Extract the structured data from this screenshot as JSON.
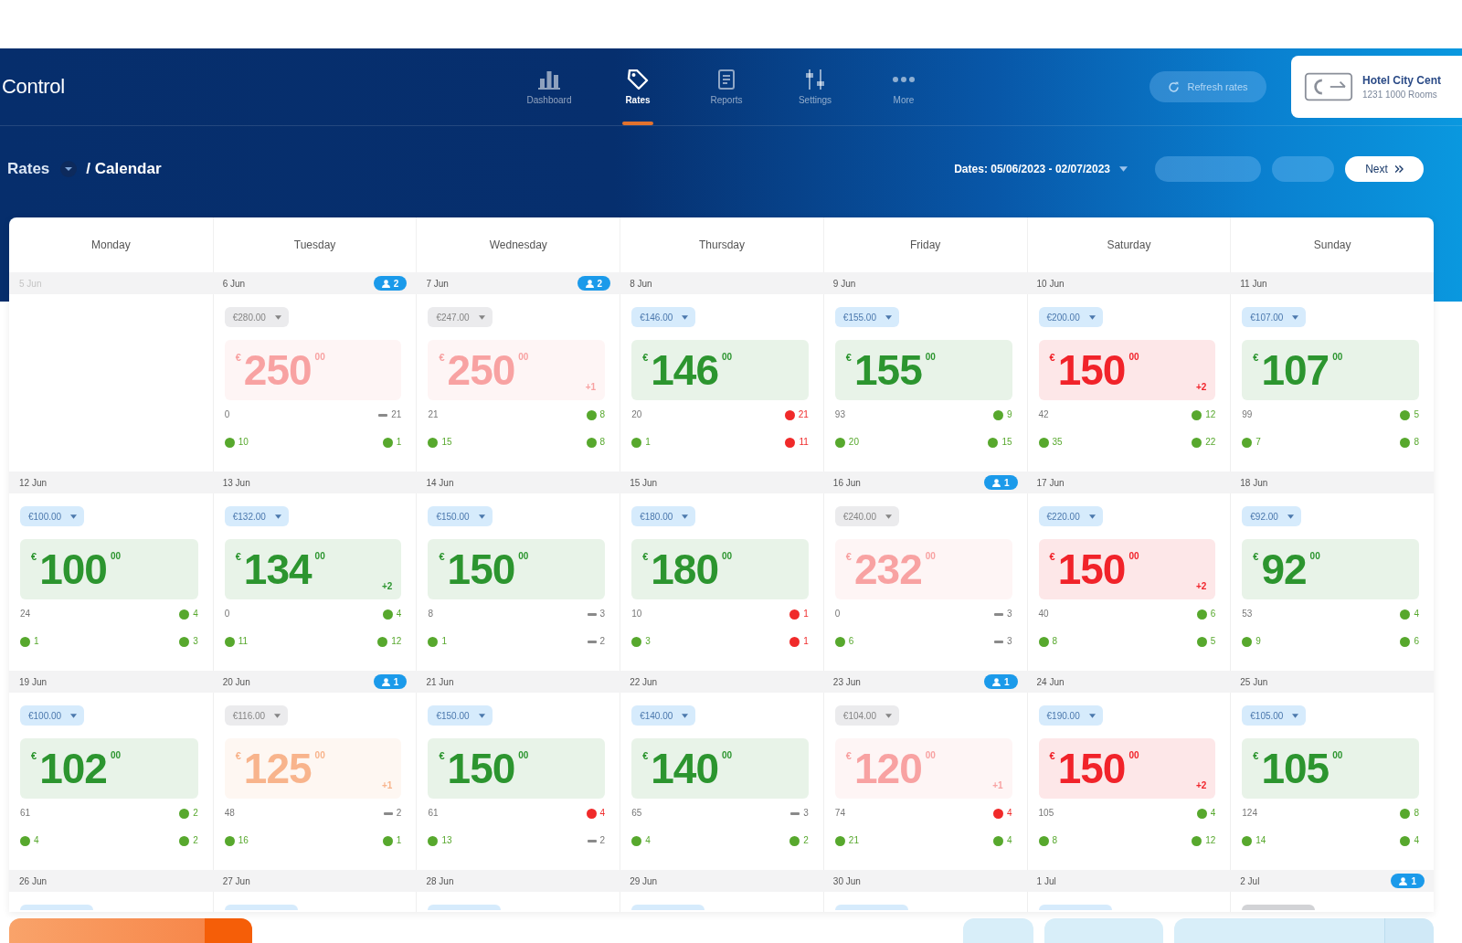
{
  "app": {
    "title": "Control"
  },
  "nav": [
    {
      "label": "Dashboard",
      "kind": "chart",
      "selected": false
    },
    {
      "label": "Rates",
      "kind": "tag",
      "selected": true
    },
    {
      "label": "Reports",
      "kind": "document",
      "selected": false
    },
    {
      "label": "Settings",
      "kind": "sliders",
      "selected": false
    },
    {
      "label": "More",
      "kind": "dots",
      "selected": false
    }
  ],
  "refresh_button": {
    "label": "Refresh rates"
  },
  "property": {
    "name": "Hotel City Cent",
    "address": "1231 1000 Rooms"
  },
  "breadcrumb": {
    "section": "Rates",
    "page": "/ Calendar"
  },
  "toolbar": {
    "dates": "Dates: 05/06/2023 - 02/07/2023",
    "buttons": [
      {
        "disabled": true
      },
      {
        "disabled": true
      },
      {
        "label": "Next",
        "disabled": false
      }
    ]
  },
  "calendar": {
    "days": [
      "Monday",
      "Tuesday",
      "Wednesday",
      "Thursday",
      "Friday",
      "Saturday",
      "Sunday"
    ],
    "weeks": [
      {
        "cells": [
          {
            "date": "5 Jun",
            "past": true
          },
          {
            "date": "6 Jun",
            "past": false,
            "badge": "2",
            "draft": true,
            "rate": "€280.00",
            "price": {
              "currency": "€",
              "amount": "250",
              "decimals": "00",
              "color": "#f8a2a2"
            },
            "availability": "0",
            "stats": [
              {
                "kind": "dash",
                "value": "21"
              },
              {
                "kind": "dot",
                "color": "#57a82d",
                "value": "10"
              },
              {
                "kind": "dot",
                "color": "#57a82d",
                "value": "1"
              }
            ]
          },
          {
            "date": "7 Jun",
            "past": false,
            "badge": "2",
            "draft": true,
            "rate": "€247.00",
            "price": {
              "currency": "€",
              "amount": "250",
              "decimals": "00",
              "color": "#f8a2a2",
              "change": "+1"
            },
            "availability": "21",
            "stats": [
              {
                "kind": "dot",
                "color": "#57a82d",
                "value": "8"
              },
              {
                "kind": "dot",
                "color": "#57a82d",
                "value": "15"
              },
              {
                "kind": "dot",
                "color": "#57a82d",
                "value": "8"
              }
            ]
          },
          {
            "date": "8 Jun",
            "past": false,
            "draft": false,
            "rate": "€146.00",
            "price": {
              "currency": "€",
              "amount": "146",
              "decimals": "00",
              "color": "#2c952f"
            },
            "availability": "20",
            "stats": [
              {
                "kind": "dot",
                "color": "#f02a2a",
                "value": "21"
              },
              {
                "kind": "dot",
                "color": "#57a82d",
                "value": "1"
              },
              {
                "kind": "dot",
                "color": "#f02a2a",
                "value": "11"
              }
            ]
          },
          {
            "date": "9 Jun",
            "past": false,
            "draft": false,
            "rate": "€155.00",
            "price": {
              "currency": "€",
              "amount": "155",
              "decimals": "00",
              "color": "#2c952f"
            },
            "availability": "93",
            "stats": [
              {
                "kind": "dot",
                "color": "#57a82d",
                "value": "9"
              },
              {
                "kind": "dot",
                "color": "#57a82d",
                "value": "20"
              },
              {
                "kind": "dot",
                "color": "#57a82d",
                "value": "15"
              }
            ]
          },
          {
            "date": "10 Jun",
            "past": false,
            "draft": false,
            "rate": "€200.00",
            "price": {
              "currency": "€",
              "amount": "150",
              "decimals": "00",
              "color": "#f1232a",
              "change": "+2"
            },
            "availability": "42",
            "stats": [
              {
                "kind": "dot",
                "color": "#57a82d",
                "value": "12"
              },
              {
                "kind": "dot",
                "color": "#57a82d",
                "value": "35"
              },
              {
                "kind": "dot",
                "color": "#57a82d",
                "value": "22"
              }
            ]
          },
          {
            "date": "11 Jun",
            "past": false,
            "draft": false,
            "rate": "€107.00",
            "price": {
              "currency": "€",
              "amount": "107",
              "decimals": "00",
              "color": "#2c952f"
            },
            "availability": "99",
            "stats": [
              {
                "kind": "dot",
                "color": "#57a82d",
                "value": "5"
              },
              {
                "kind": "dot",
                "color": "#57a82d",
                "value": "7"
              },
              {
                "kind": "dot",
                "color": "#57a82d",
                "value": "8"
              }
            ]
          }
        ]
      },
      {
        "cells": [
          {
            "date": "12 Jun",
            "past": false,
            "draft": false,
            "rate": "€100.00",
            "price": {
              "currency": "€",
              "amount": "100",
              "decimals": "00",
              "color": "#2c952f"
            },
            "availability": "24",
            "stats": [
              {
                "kind": "dot",
                "color": "#57a82d",
                "value": "4"
              },
              {
                "kind": "dot",
                "color": "#57a82d",
                "value": "1"
              },
              {
                "kind": "dot",
                "color": "#57a82d",
                "value": "3"
              }
            ]
          },
          {
            "date": "13 Jun",
            "past": false,
            "draft": false,
            "rate": "€132.00",
            "price": {
              "currency": "€",
              "amount": "134",
              "decimals": "00",
              "color": "#2c952f",
              "change": "+2"
            },
            "availability": "0",
            "stats": [
              {
                "kind": "dot",
                "color": "#57a82d",
                "value": "4"
              },
              {
                "kind": "dot",
                "color": "#57a82d",
                "value": "11"
              },
              {
                "kind": "dot",
                "color": "#57a82d",
                "value": "12"
              }
            ]
          },
          {
            "date": "14 Jun",
            "past": false,
            "draft": false,
            "rate": "€150.00",
            "price": {
              "currency": "€",
              "amount": "150",
              "decimals": "00",
              "color": "#2c952f"
            },
            "availability": "8",
            "stats": [
              {
                "kind": "dash",
                "value": "3"
              },
              {
                "kind": "dot",
                "color": "#57a82d",
                "value": "1"
              },
              {
                "kind": "dash",
                "value": "2"
              }
            ]
          },
          {
            "date": "15 Jun",
            "past": false,
            "draft": false,
            "rate": "€180.00",
            "price": {
              "currency": "€",
              "amount": "180",
              "decimals": "00",
              "color": "#2c952f"
            },
            "availability": "10",
            "stats": [
              {
                "kind": "dot",
                "color": "#f02a2a",
                "value": "1"
              },
              {
                "kind": "dot",
                "color": "#57a82d",
                "value": "3"
              },
              {
                "kind": "dot",
                "color": "#f02a2a",
                "value": "1"
              }
            ]
          },
          {
            "date": "16 Jun",
            "past": false,
            "badge": "1",
            "draft": true,
            "rate": "€240.00",
            "price": {
              "currency": "€",
              "amount": "232",
              "decimals": "00",
              "color": "#f8a2a2"
            },
            "availability": "0",
            "stats": [
              {
                "kind": "dash",
                "value": "3"
              },
              {
                "kind": "dot",
                "color": "#57a82d",
                "value": "6"
              },
              {
                "kind": "dash",
                "value": "3"
              }
            ]
          },
          {
            "date": "17 Jun",
            "past": false,
            "draft": false,
            "rate": "€220.00",
            "price": {
              "currency": "€",
              "amount": "150",
              "decimals": "00",
              "color": "#f1232a",
              "change": "+2"
            },
            "availability": "40",
            "stats": [
              {
                "kind": "dot",
                "color": "#57a82d",
                "value": "6"
              },
              {
                "kind": "dot",
                "color": "#57a82d",
                "value": "8"
              },
              {
                "kind": "dot",
                "color": "#57a82d",
                "value": "5"
              }
            ]
          },
          {
            "date": "18 Jun",
            "past": false,
            "draft": false,
            "rate": "€92.00",
            "price": {
              "currency": "€",
              "amount": "92",
              "decimals": "00",
              "color": "#2c952f"
            },
            "availability": "53",
            "stats": [
              {
                "kind": "dot",
                "color": "#57a82d",
                "value": "4"
              },
              {
                "kind": "dot",
                "color": "#57a82d",
                "value": "9"
              },
              {
                "kind": "dot",
                "color": "#57a82d",
                "value": "6"
              }
            ]
          }
        ]
      },
      {
        "cells": [
          {
            "date": "19 Jun",
            "past": false,
            "draft": false,
            "rate": "€100.00",
            "price": {
              "currency": "€",
              "amount": "102",
              "decimals": "00",
              "color": "#2c952f"
            },
            "availability": "61",
            "stats": [
              {
                "kind": "dot",
                "color": "#57a82d",
                "value": "2"
              },
              {
                "kind": "dot",
                "color": "#57a82d",
                "value": "4"
              },
              {
                "kind": "dot",
                "color": "#57a82d",
                "value": "2"
              }
            ]
          },
          {
            "date": "20 Jun",
            "past": false,
            "badge": "1",
            "draft": true,
            "rate": "€116.00",
            "price": {
              "currency": "€",
              "amount": "125",
              "decimals": "00",
              "color": "#f8b48c",
              "change": "+1"
            },
            "availability": "48",
            "stats": [
              {
                "kind": "dash",
                "value": "2"
              },
              {
                "kind": "dot",
                "color": "#57a82d",
                "value": "16"
              },
              {
                "kind": "dot",
                "color": "#57a82d",
                "value": "1"
              }
            ]
          },
          {
            "date": "21 Jun",
            "past": false,
            "draft": false,
            "rate": "€150.00",
            "price": {
              "currency": "€",
              "amount": "150",
              "decimals": "00",
              "color": "#2c952f"
            },
            "availability": "61",
            "stats": [
              {
                "kind": "dot",
                "color": "#f02a2a",
                "value": "4"
              },
              {
                "kind": "dot",
                "color": "#57a82d",
                "value": "13"
              },
              {
                "kind": "dash",
                "value": "2"
              }
            ]
          },
          {
            "date": "22 Jun",
            "past": false,
            "draft": false,
            "rate": "€140.00",
            "price": {
              "currency": "€",
              "amount": "140",
              "decimals": "00",
              "color": "#2c952f"
            },
            "availability": "65",
            "stats": [
              {
                "kind": "dash",
                "value": "3"
              },
              {
                "kind": "dot",
                "color": "#57a82d",
                "value": "4"
              },
              {
                "kind": "dot",
                "color": "#57a82d",
                "value": "2"
              }
            ]
          },
          {
            "date": "23 Jun",
            "past": false,
            "badge": "1",
            "draft": true,
            "rate": "€104.00",
            "price": {
              "currency": "€",
              "amount": "120",
              "decimals": "00",
              "color": "#f8a2a2",
              "change": "+1"
            },
            "availability": "74",
            "stats": [
              {
                "kind": "dot",
                "color": "#f02a2a",
                "value": "4"
              },
              {
                "kind": "dot",
                "color": "#57a82d",
                "value": "21"
              },
              {
                "kind": "dot",
                "color": "#57a82d",
                "value": "4"
              }
            ]
          },
          {
            "date": "24 Jun",
            "past": false,
            "draft": false,
            "rate": "€190.00",
            "price": {
              "currency": "€",
              "amount": "150",
              "decimals": "00",
              "color": "#f1232a",
              "change": "+2"
            },
            "availability": "105",
            "stats": [
              {
                "kind": "dot",
                "color": "#57a82d",
                "value": "4"
              },
              {
                "kind": "dot",
                "color": "#57a82d",
                "value": "8"
              },
              {
                "kind": "dot",
                "color": "#57a82d",
                "value": "12"
              }
            ]
          },
          {
            "date": "25 Jun",
            "past": false,
            "draft": false,
            "rate": "€105.00",
            "price": {
              "currency": "€",
              "amount": "105",
              "decimals": "00",
              "color": "#2c952f"
            },
            "availability": "124",
            "stats": [
              {
                "kind": "dot",
                "color": "#57a82d",
                "value": "8"
              },
              {
                "kind": "dot",
                "color": "#57a82d",
                "value": "14"
              },
              {
                "kind": "dot",
                "color": "#57a82d",
                "value": "4"
              }
            ]
          }
        ]
      },
      {
        "cells": [
          {
            "date": "26 Jun",
            "past": false,
            "draft": false
          },
          {
            "date": "27 Jun",
            "past": false,
            "draft": false
          },
          {
            "date": "28 Jun",
            "past": false,
            "draft": false
          },
          {
            "date": "29 Jun",
            "past": false,
            "draft": false
          },
          {
            "date": "30 Jun",
            "past": false,
            "draft": false
          },
          {
            "date": "1 Jul",
            "past": false,
            "draft": false
          },
          {
            "date": "2 Jul",
            "past": false,
            "badge": "1",
            "draft": true
          }
        ]
      }
    ]
  },
  "footer": {
    "buttons": [
      {
        "kind": "primary",
        "split": true
      },
      {
        "kind": "secondary",
        "split": false
      },
      {
        "kind": "secondary",
        "split": false
      },
      {
        "kind": "secondary",
        "split": true
      }
    ]
  }
}
